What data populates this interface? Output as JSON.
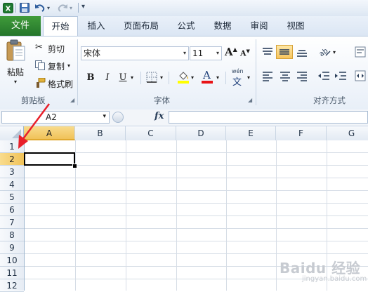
{
  "qat": {
    "icons": [
      "excel-app-icon",
      "save-icon",
      "undo-icon",
      "redo-icon",
      "customize-qat-icon"
    ]
  },
  "tabs": [
    {
      "id": "file",
      "label": "文件"
    },
    {
      "id": "home",
      "label": "开始"
    },
    {
      "id": "insert",
      "label": "插入"
    },
    {
      "id": "layout",
      "label": "页面布局"
    },
    {
      "id": "formulas",
      "label": "公式"
    },
    {
      "id": "data",
      "label": "数据"
    },
    {
      "id": "review",
      "label": "审阅"
    },
    {
      "id": "view",
      "label": "视图"
    }
  ],
  "clipboard": {
    "paste_label": "粘贴",
    "cut_label": "剪切",
    "copy_label": "复制",
    "format_painter_label": "格式刷",
    "group_label": "剪贴板"
  },
  "font": {
    "font_name": "宋体",
    "font_size": "11",
    "bold": "B",
    "italic": "I",
    "underline": "U",
    "grow": "A",
    "shrink": "A",
    "font_color_letter": "A",
    "phonetic_top": "wén",
    "phonetic_char": "文",
    "group_label": "字体",
    "colors": {
      "highlight": "#ffff00",
      "font_color": "#e81416"
    }
  },
  "alignment": {
    "group_label": "对齐方式"
  },
  "formula_bar": {
    "name_box": "A2",
    "fx": "fx",
    "value": ""
  },
  "grid": {
    "columns": [
      "A",
      "B",
      "C",
      "D",
      "E",
      "F",
      "G"
    ],
    "rows": [
      "1",
      "2",
      "3",
      "4",
      "5",
      "6",
      "7",
      "8",
      "9",
      "10",
      "11",
      "12"
    ],
    "selected_column": "A",
    "selected_row": "2"
  },
  "watermark": {
    "text": "Baidu 经验",
    "sub": "jingyan.baidu.com"
  },
  "colors": {
    "file_tab": "#2a7d2e",
    "selection_header": "#f0c259",
    "annotation_arrow": "#e8202a"
  }
}
